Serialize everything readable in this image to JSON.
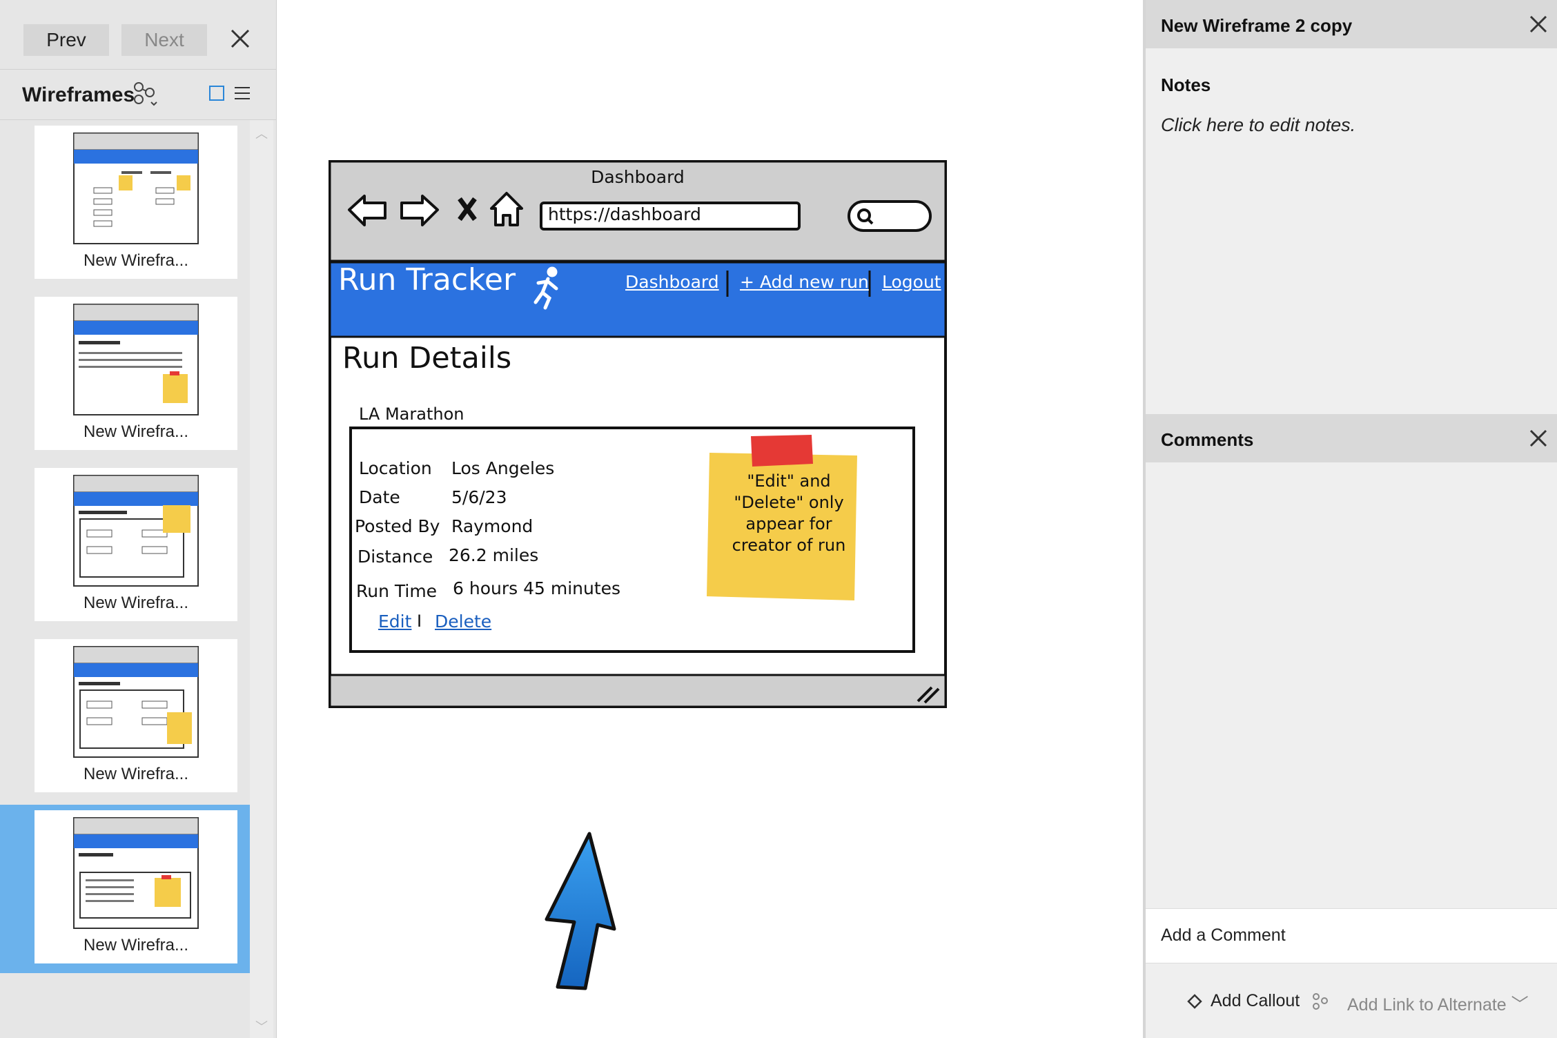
{
  "left_panel": {
    "prev_label": "Prev",
    "next_label": "Next",
    "section_title": "Wireframes",
    "thumbnails": [
      {
        "label": "New Wirefra..."
      },
      {
        "label": "New Wirefra..."
      },
      {
        "label": "New Wirefra..."
      },
      {
        "label": "New Wirefra..."
      },
      {
        "label": "New Wirefra..."
      }
    ],
    "selected_index": 4
  },
  "mockup": {
    "window_title": "Dashboard",
    "url": "https://dashboard",
    "app_name": "Run Tracker",
    "nav": {
      "dashboard": "Dashboard",
      "add_run": "+ Add new run",
      "logout": "Logout"
    },
    "heading": "Run Details",
    "run_name": "LA Marathon",
    "fields": [
      {
        "label": "Location",
        "value": "Los Angeles"
      },
      {
        "label": "Date",
        "value": "5/6/23"
      },
      {
        "label": "Posted By",
        "value": "Raymond"
      },
      {
        "label": "Distance",
        "value": "26.2 miles"
      },
      {
        "label": "Run Time",
        "value": "6 hours 45 minutes"
      }
    ],
    "edit_label": "Edit",
    "separator": "I",
    "delete_label": "Delete",
    "sticky_note": "\"Edit\" and \"Delete\" only appear for creator of run"
  },
  "right_panel": {
    "title": "New Wireframe 2 copy",
    "notes_heading": "Notes",
    "notes_placeholder": "Click here to edit notes.",
    "comments_heading": "Comments",
    "comment_placeholder": "Add a Comment",
    "add_callout": "Add Callout",
    "add_link": "Add Link to Alternate"
  },
  "colors": {
    "app_header_blue": "#2b72e0",
    "selection_blue": "#6bb2ec",
    "link_blue": "#1a5fbf",
    "sticky_yellow": "#f5cc4a",
    "sticky_tape_red": "#e53935",
    "arrow_blue": "#1e88e5"
  }
}
